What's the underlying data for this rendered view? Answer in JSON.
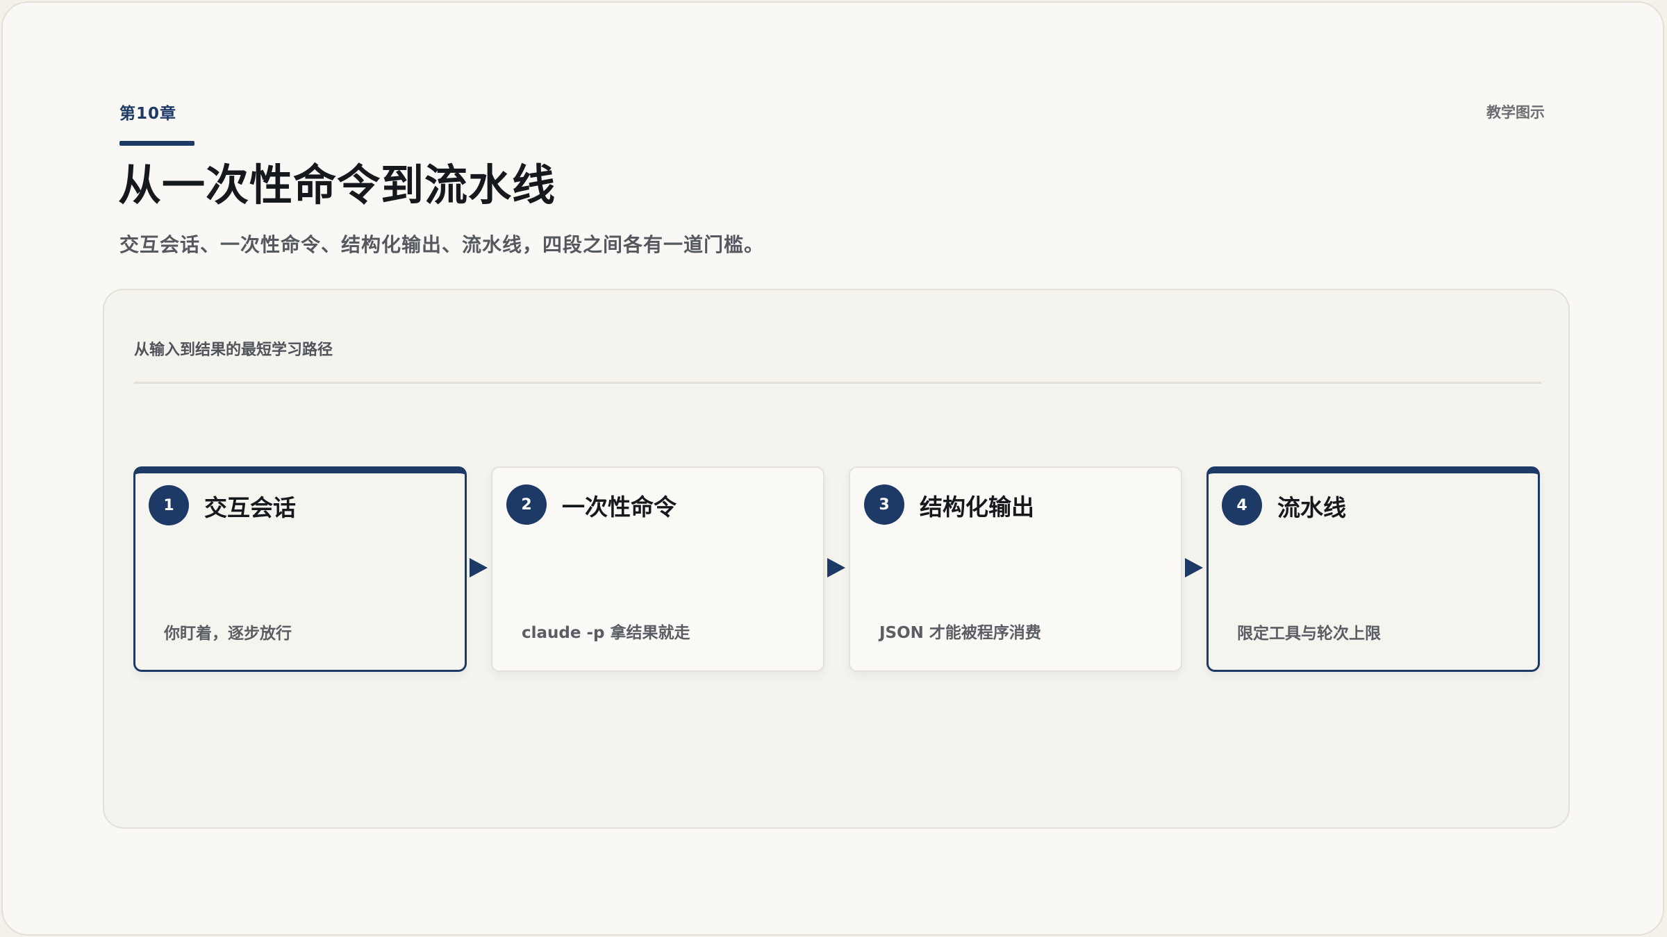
{
  "header": {
    "chapter": "第10章",
    "kind": "教学图示",
    "title": "从一次性命令到流水线",
    "subtitle": "交互会话、一次性命令、结构化输出、流水线，四段之间各有一道门槛。"
  },
  "panel": {
    "label": "从输入到结果的最短学习路径"
  },
  "steps": [
    {
      "number": "1",
      "title": "交互会话",
      "desc": "你盯着，逐步放行",
      "highlighted": true
    },
    {
      "number": "2",
      "title": "一次性命令",
      "desc": "claude -p 拿结果就走",
      "highlighted": false
    },
    {
      "number": "3",
      "title": "结构化输出",
      "desc": "JSON 才能被程序消费",
      "highlighted": false
    },
    {
      "number": "4",
      "title": "流水线",
      "desc": "限定工具与轮次上限",
      "highlighted": true
    }
  ],
  "colors": {
    "accent": "#1d3a66",
    "background": "#f9f8f4",
    "panel": "#f4f3ee"
  },
  "icons": {
    "connector": "arrow-right-icon"
  }
}
